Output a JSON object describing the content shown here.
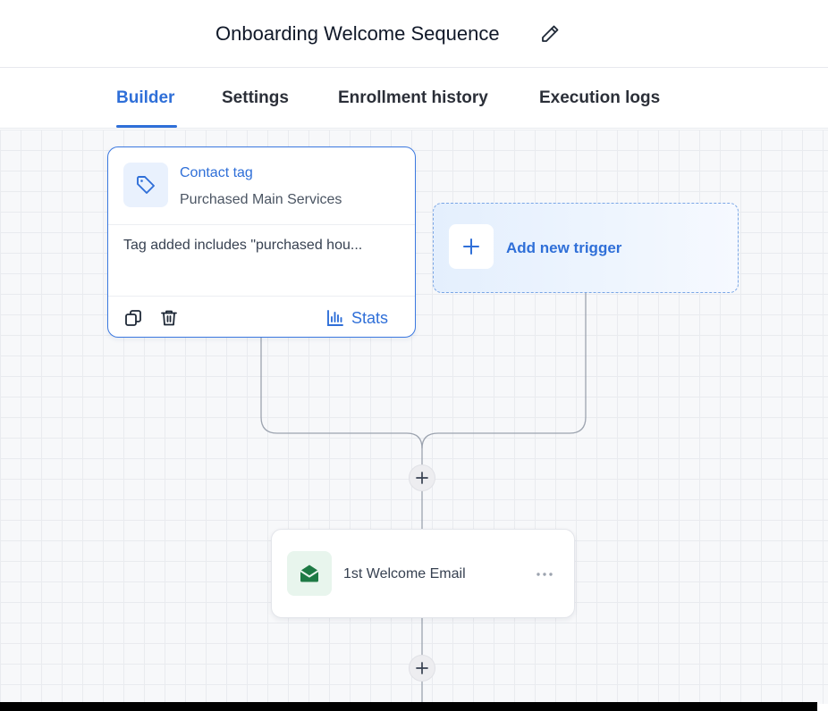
{
  "header": {
    "title": "Onboarding Welcome Sequence",
    "edit_icon": "pencil-icon"
  },
  "tabs": [
    {
      "label": "Builder",
      "active": true
    },
    {
      "label": "Settings",
      "active": false
    },
    {
      "label": "Enrollment history",
      "active": false
    },
    {
      "label": "Execution logs",
      "active": false
    }
  ],
  "trigger_card": {
    "icon": "tag-icon",
    "name": "Contact tag",
    "subtitle": "Purchased Main Services",
    "description": "Tag added includes \"purchased hou...",
    "actions": {
      "copy_icon": "copy-icon",
      "delete_icon": "trash-icon",
      "stats_icon": "bar-chart-icon",
      "stats_label": "Stats"
    }
  },
  "add_trigger": {
    "icon": "plus-icon",
    "label": "Add new trigger"
  },
  "email_step": {
    "icon": "envelope-icon",
    "name": "1st Welcome Email",
    "menu_icon": "ellipsis-icon"
  },
  "colors": {
    "accent": "#2f6fd8",
    "email_icon": "#1e7a45",
    "connector": "#9ca3af",
    "canvas_bg": "#f7f8fa"
  }
}
